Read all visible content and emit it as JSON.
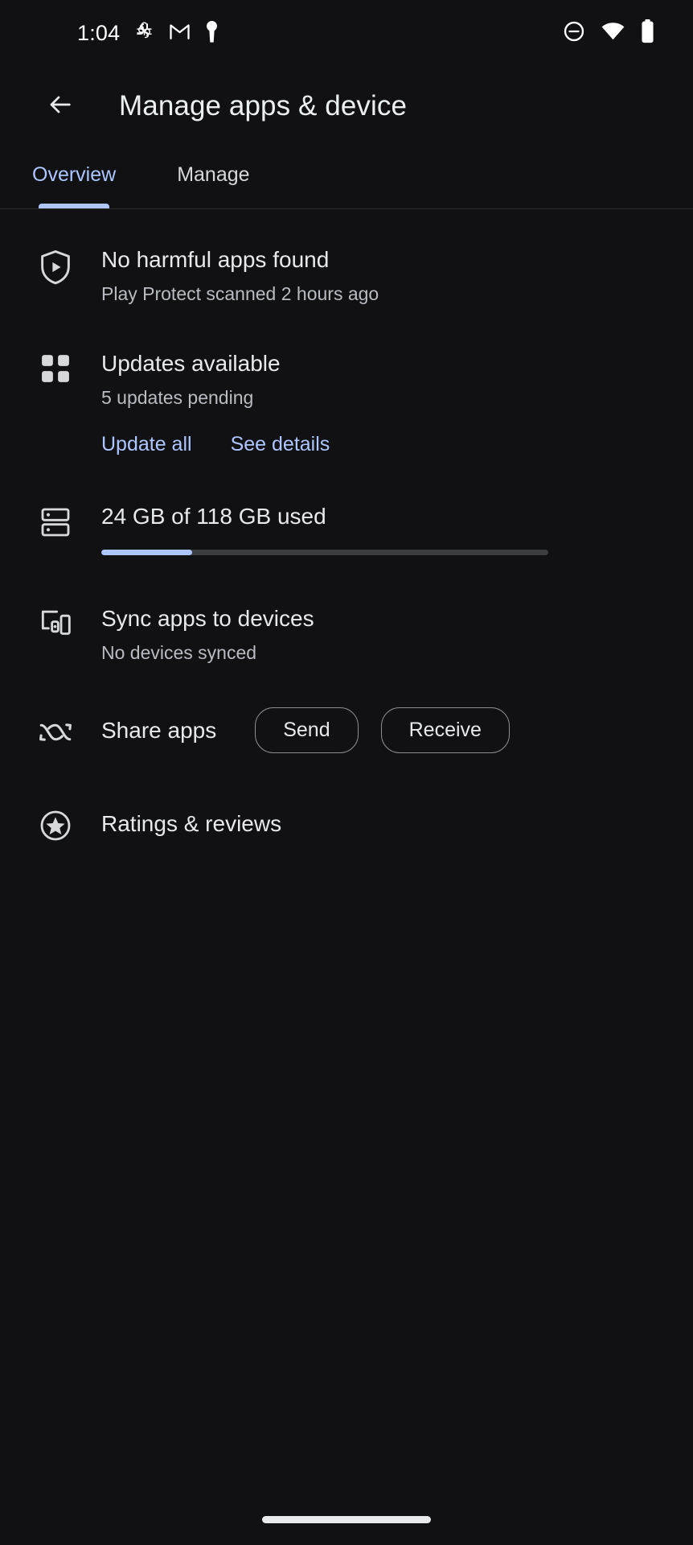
{
  "status_bar": {
    "time": "1:04",
    "left_icons": [
      "photos-icon",
      "gmail-icon",
      "vpn-key-icon"
    ],
    "right_icons": [
      "do-not-disturb-icon",
      "wifi-icon",
      "battery-icon"
    ]
  },
  "app_bar": {
    "back_icon": "back-arrow-icon",
    "title": "Manage apps & device"
  },
  "tabs": {
    "items": [
      {
        "label": "Overview",
        "active": true
      },
      {
        "label": "Manage",
        "active": false
      }
    ],
    "active_color": "#adc6ff",
    "inactive_color": "#d6d8dc"
  },
  "rows": {
    "play_protect": {
      "icon": "shield-play-protect-icon",
      "title": "No harmful apps found",
      "subtitle": "Play Protect scanned 2 hours ago"
    },
    "updates": {
      "icon": "apps-grid-icon",
      "title": "Updates available",
      "subtitle": "5 updates pending",
      "actions": [
        {
          "label": "Update all"
        },
        {
          "label": "See details"
        }
      ]
    },
    "storage": {
      "icon": "storage-icon",
      "title": "24 GB of 118 GB used",
      "used_gb": 24,
      "total_gb": 118,
      "percent": "20%"
    },
    "sync": {
      "icon": "devices-sync-icon",
      "title": "Sync apps to devices",
      "subtitle": "No devices synced"
    },
    "share": {
      "icon": "share-apps-icon",
      "title": "Share apps",
      "buttons": [
        {
          "label": "Send"
        },
        {
          "label": "Receive"
        }
      ]
    },
    "ratings": {
      "icon": "star-circle-icon",
      "title": "Ratings & reviews"
    }
  },
  "nav_bar": {
    "home_indicator": "home-gesture-pill"
  },
  "colors": {
    "background": "#111113",
    "accent": "#adc6ff",
    "primary_text": "#e7e9ec",
    "secondary_text": "#b9bcc2"
  }
}
